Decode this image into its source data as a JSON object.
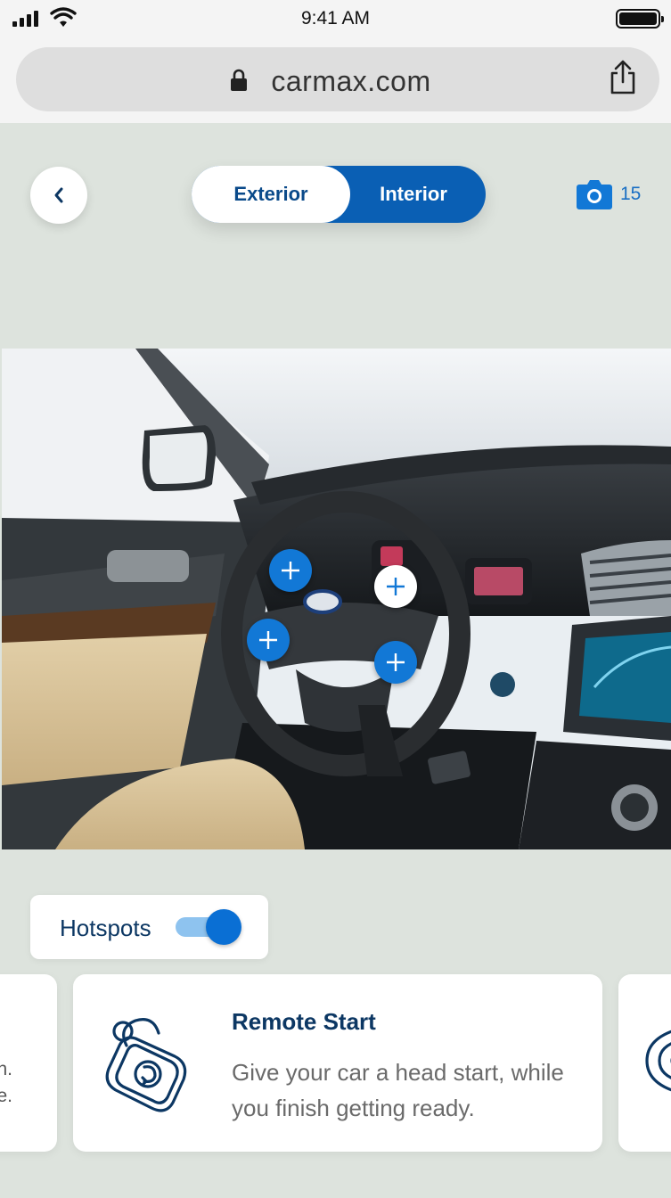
{
  "status_bar": {
    "time": "9:41 AM"
  },
  "browser": {
    "url": "carmax.com"
  },
  "view_toggle": {
    "exterior_label": "Exterior",
    "interior_label": "Interior",
    "selected": "Interior"
  },
  "photos": {
    "count": "15",
    "icon": "camera-icon"
  },
  "hotspots": {
    "label": "Hotspots",
    "enabled": true,
    "markers": [
      {
        "id": "steering-left-top",
        "active": false
      },
      {
        "id": "steering-center-right",
        "active": true
      },
      {
        "id": "steering-left-bottom",
        "active": false
      },
      {
        "id": "steering-right-bottom",
        "active": false
      }
    ]
  },
  "feature_cards": {
    "prev_partial": {
      "line1": "n.",
      "line2": "e."
    },
    "current": {
      "title": "Remote Start",
      "description": "Give your car a head start, while you finish getting ready.",
      "icon": "key-fob-icon"
    },
    "next_partial": {
      "icon": "wireless-icon"
    }
  },
  "colors": {
    "accent": "#0A5FB4",
    "hotspot": "#1278D6",
    "title": "#0C3763",
    "background": "#DDE3DD"
  }
}
